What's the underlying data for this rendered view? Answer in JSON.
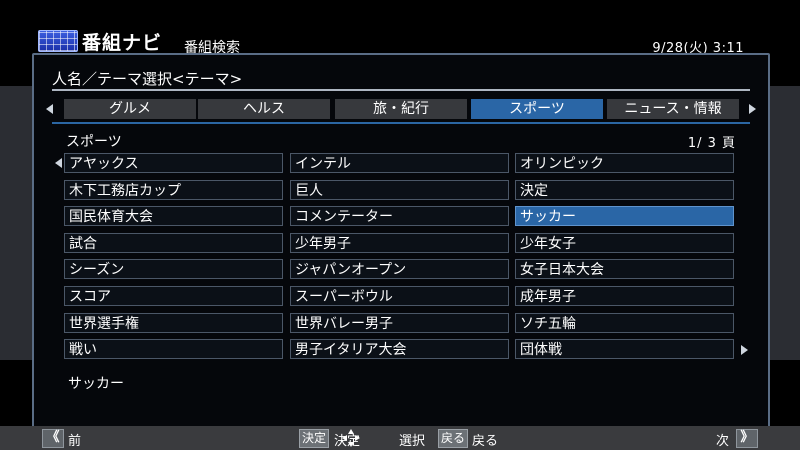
{
  "header": {
    "app_title": "番組ナビ",
    "sub_title": "番組検索",
    "datetime": "9/28(火) 3:11"
  },
  "panel": {
    "heading": "人名／テーマ選択<テーマ>",
    "tabs": [
      {
        "label": "グルメ",
        "active": false
      },
      {
        "label": "ヘルス",
        "active": false
      },
      {
        "label": "旅・紀行",
        "active": false
      },
      {
        "label": "スポーツ",
        "active": true
      },
      {
        "label": "ニュース・情報",
        "active": false
      }
    ],
    "category_label": "スポーツ",
    "page_indicator": "1/ 3 頁",
    "grid": [
      [
        "アヤックス",
        "インテル",
        "オリンピック"
      ],
      [
        "木下工務店カップ",
        "巨人",
        "決定"
      ],
      [
        "国民体育大会",
        "コメンテーター",
        "サッカー"
      ],
      [
        "試合",
        "少年男子",
        "少年女子"
      ],
      [
        "シーズン",
        "ジャパンオープン",
        "女子日本大会"
      ],
      [
        "スコア",
        "スーパーボウル",
        "成年男子"
      ],
      [
        "世界選手権",
        "世界バレー男子",
        "ソチ五輪"
      ],
      [
        "戦い",
        "男子イタリア大会",
        "団体戦"
      ]
    ],
    "selected_cell": [
      2,
      2
    ],
    "selection_text": "サッカー"
  },
  "footer": {
    "prev_symbol": "《",
    "prev_label": "前",
    "decide_key": "決定",
    "decide_label": "決定",
    "select_label": "選択",
    "back_key": "戻る",
    "back_label": "戻る",
    "next_label": "次",
    "next_symbol": "》"
  },
  "colors": {
    "accent_blue": "#2a66a6",
    "tab_gray": "#37393d",
    "panel_border": "#5a6d86"
  }
}
